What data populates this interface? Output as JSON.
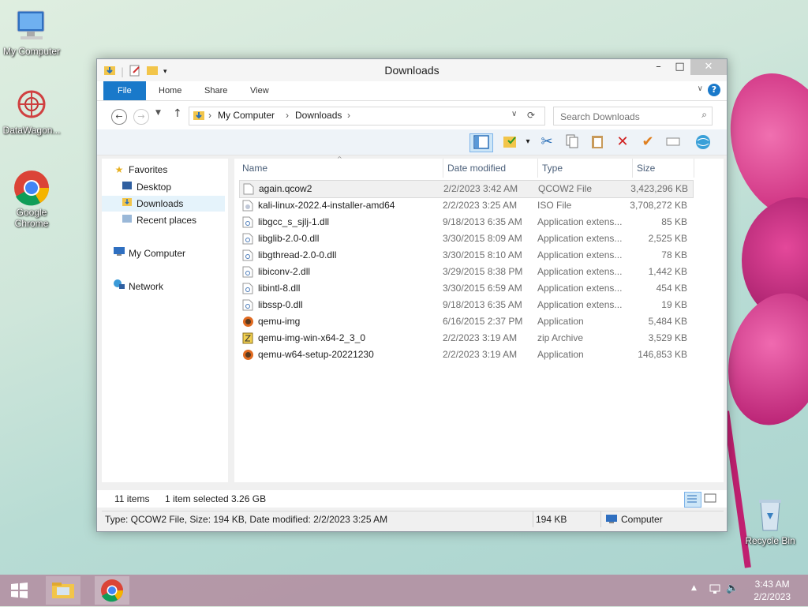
{
  "desktop": {
    "icons": [
      {
        "label": "My Computer"
      },
      {
        "label": "DataWagon..."
      },
      {
        "label": "Google Chrome"
      },
      {
        "label": "Recycle Bin"
      }
    ]
  },
  "window": {
    "title": "Downloads",
    "tabs": {
      "file": "File",
      "home": "Home",
      "share": "Share",
      "view": "View"
    },
    "address": {
      "root": "My Computer",
      "current": "Downloads"
    },
    "search": {
      "placeholder": "Search Downloads"
    },
    "nav": {
      "favorites": "Favorites",
      "desktop": "Desktop",
      "downloads": "Downloads",
      "recent": "Recent places",
      "computer": "My Computer",
      "network": "Network"
    },
    "columns": {
      "name": "Name",
      "date": "Date modified",
      "type": "Type",
      "size": "Size"
    },
    "files": [
      {
        "name": "again.qcow2",
        "date": "2/2/2023 3:42 AM",
        "type": "QCOW2 File",
        "size": "3,423,296 KB",
        "icon": "file-icon",
        "selected": true
      },
      {
        "name": "kali-linux-2022.4-installer-amd64",
        "date": "2/2/2023 3:25 AM",
        "type": "ISO File",
        "size": "3,708,272 KB",
        "icon": "iso-icon"
      },
      {
        "name": "libgcc_s_sjlj-1.dll",
        "date": "9/18/2013 6:35 AM",
        "type": "Application extens...",
        "size": "85 KB",
        "icon": "dll-icon"
      },
      {
        "name": "libglib-2.0-0.dll",
        "date": "3/30/2015 8:09 AM",
        "type": "Application extens...",
        "size": "2,525 KB",
        "icon": "dll-icon"
      },
      {
        "name": "libgthread-2.0-0.dll",
        "date": "3/30/2015 8:10 AM",
        "type": "Application extens...",
        "size": "78 KB",
        "icon": "dll-icon"
      },
      {
        "name": "libiconv-2.dll",
        "date": "3/29/2015 8:38 PM",
        "type": "Application extens...",
        "size": "1,442 KB",
        "icon": "dll-icon"
      },
      {
        "name": "libintl-8.dll",
        "date": "3/30/2015 6:59 AM",
        "type": "Application extens...",
        "size": "454 KB",
        "icon": "dll-icon"
      },
      {
        "name": "libssp-0.dll",
        "date": "9/18/2013 6:35 AM",
        "type": "Application extens...",
        "size": "19 KB",
        "icon": "dll-icon"
      },
      {
        "name": "qemu-img",
        "date": "6/16/2015 2:37 PM",
        "type": "Application",
        "size": "5,484 KB",
        "icon": "qemu-icon"
      },
      {
        "name": "qemu-img-win-x64-2_3_0",
        "date": "2/2/2023 3:19 AM",
        "type": "zip Archive",
        "size": "3,529 KB",
        "icon": "zip-icon"
      },
      {
        "name": "qemu-w64-setup-20221230",
        "date": "2/2/2023 3:19 AM",
        "type": "Application",
        "size": "146,853 KB",
        "icon": "qemu-icon"
      }
    ],
    "status": {
      "items": "11 items",
      "selection": "1 item selected  3.26 GB",
      "details": "Type: QCOW2 File, Size: 194 KB, Date modified: 2/2/2023 3:25 AM",
      "size": "194 KB",
      "location": "Computer"
    }
  },
  "taskbar": {
    "time": "3:43 AM",
    "date": "2/2/2023"
  },
  "colors": {
    "accent": "#1979ca",
    "selection": "#e5f3fb",
    "taskbar": "#b48ca0"
  }
}
